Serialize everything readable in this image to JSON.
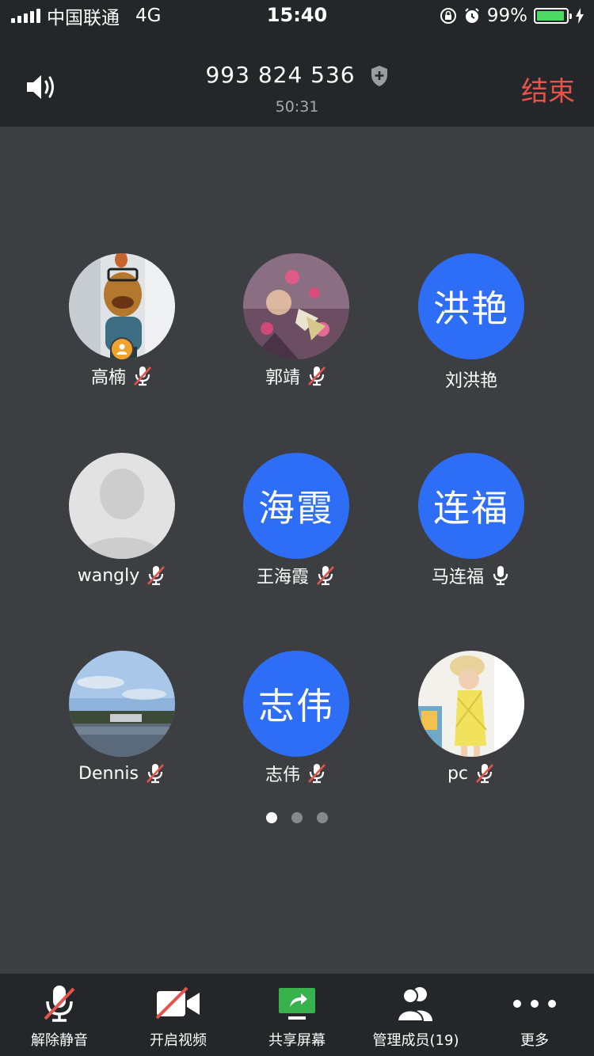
{
  "status_bar": {
    "carrier": "中国联通",
    "network": "4G",
    "time": "15:40",
    "battery_pct": "99%",
    "battery_level": 0.99
  },
  "header": {
    "meeting_id": "993 824 536",
    "duration": "50:31",
    "end_label": "结束",
    "end_color": "#e5534b"
  },
  "participants": [
    {
      "name": "高楠",
      "avatar_type": "photo",
      "avatar_icon": "puppet-photo",
      "mic": "muted",
      "host": true
    },
    {
      "name": "郭靖",
      "avatar_type": "photo",
      "avatar_icon": "flowers-photo",
      "mic": "muted"
    },
    {
      "name": "刘洪艳",
      "avatar_type": "text",
      "avatar_text": "洪艳",
      "mic": "none"
    },
    {
      "name": "wangly",
      "avatar_type": "default",
      "avatar_icon": "default-person",
      "mic": "muted"
    },
    {
      "name": "王海霞",
      "avatar_type": "text",
      "avatar_text": "海霞",
      "mic": "muted"
    },
    {
      "name": "马连福",
      "avatar_type": "text",
      "avatar_text": "连福",
      "mic": "on"
    },
    {
      "name": "Dennis",
      "avatar_type": "photo",
      "avatar_icon": "lake-photo",
      "mic": "muted"
    },
    {
      "name": "志伟",
      "avatar_type": "text",
      "avatar_text": "志伟",
      "mic": "muted"
    },
    {
      "name": "pc",
      "avatar_type": "photo",
      "avatar_icon": "child-photo",
      "mic": "muted"
    }
  ],
  "pagination": {
    "pages": 3,
    "current": 1
  },
  "toolbar": {
    "unmute": "解除静音",
    "video": "开启视频",
    "share": "共享屏幕",
    "members": "管理成员(19)",
    "more": "更多"
  },
  "colors": {
    "accent_blue": "#2e6ef7",
    "share_green": "#37b24d",
    "mute_red": "#e5534b"
  }
}
